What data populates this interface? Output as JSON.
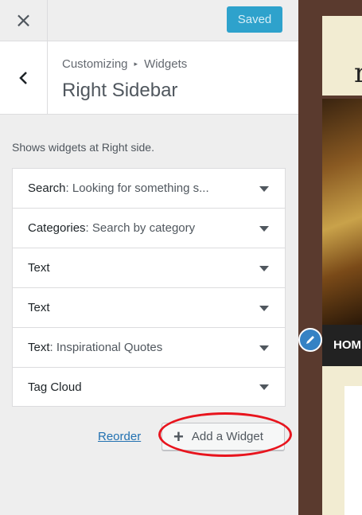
{
  "topbar": {
    "close_icon": "×",
    "saved_label": "Saved"
  },
  "header": {
    "breadcrumb_parent": "Customizing",
    "breadcrumb_sep": "▸",
    "breadcrumb_section": "Widgets",
    "title": "Right Sidebar"
  },
  "description": "Shows widgets at Right side.",
  "widgets": [
    {
      "title": "Search",
      "info": ": Looking for something s..."
    },
    {
      "title": "Categories",
      "info": ": Search by category"
    },
    {
      "title": "Text",
      "info": ""
    },
    {
      "title": "Text",
      "info": ""
    },
    {
      "title": "Text",
      "info": ": Inspirational Quotes"
    },
    {
      "title": "Tag Cloud",
      "info": ""
    }
  ],
  "actions": {
    "reorder_label": "Reorder",
    "add_widget_label": "Add a Widget",
    "add_icon": "+"
  },
  "preview": {
    "nav_label": "HOM",
    "heading_fragment": "r"
  },
  "colors": {
    "saved_button": "#2ea2cc",
    "link": "#2271b1",
    "highlight": "#e8141d",
    "edit_shortcut": "#3582c4"
  }
}
